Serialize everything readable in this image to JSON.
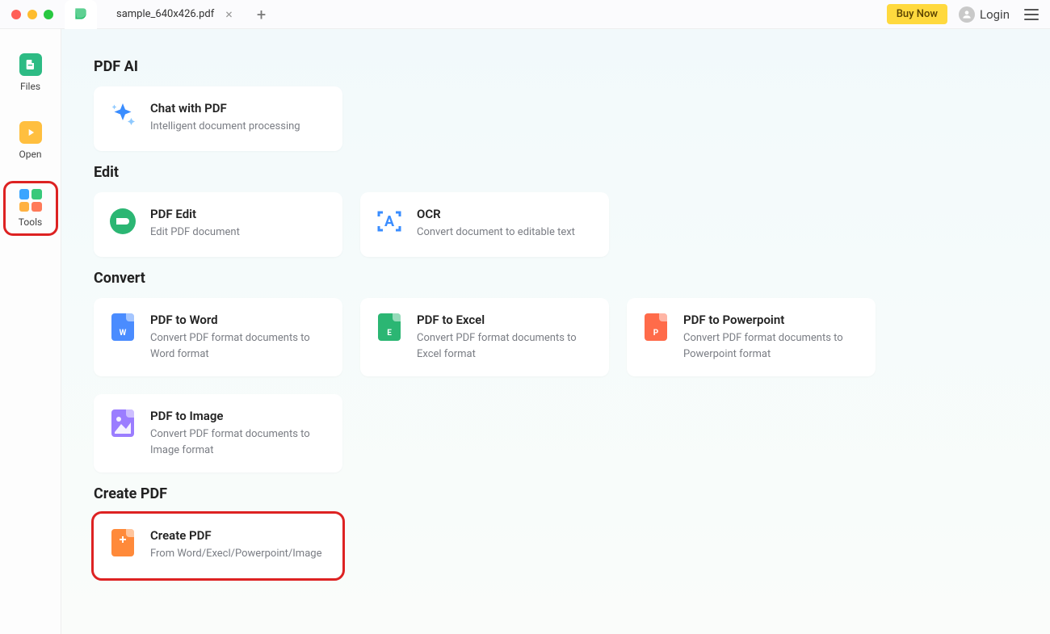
{
  "titlebar": {
    "tab_name": "sample_640x426.pdf",
    "buy_now": "Buy Now",
    "login": "Login"
  },
  "sidebar": {
    "items": [
      {
        "label": "Files"
      },
      {
        "label": "Open"
      },
      {
        "label": "Tools"
      }
    ]
  },
  "sections": {
    "pdfai": {
      "title": "PDF AI",
      "cards": [
        {
          "title": "Chat with PDF",
          "desc": "Intelligent document processing"
        }
      ]
    },
    "edit": {
      "title": "Edit",
      "cards": [
        {
          "title": "PDF Edit",
          "desc": "Edit PDF document"
        },
        {
          "title": "OCR",
          "desc": "Convert document to editable text"
        }
      ]
    },
    "convert": {
      "title": "Convert",
      "cards": [
        {
          "title": "PDF to Word",
          "desc": "Convert PDF format documents to Word format"
        },
        {
          "title": "PDF to Excel",
          "desc": "Convert PDF format documents to Excel format"
        },
        {
          "title": "PDF to Powerpoint",
          "desc": "Convert PDF format documents to Powerpoint format"
        },
        {
          "title": "PDF to Image",
          "desc": "Convert PDF format documents to Image format"
        }
      ]
    },
    "create": {
      "title": "Create PDF",
      "cards": [
        {
          "title": "Create PDF",
          "desc": "From Word/Execl/Powerpoint/Image"
        }
      ]
    }
  }
}
